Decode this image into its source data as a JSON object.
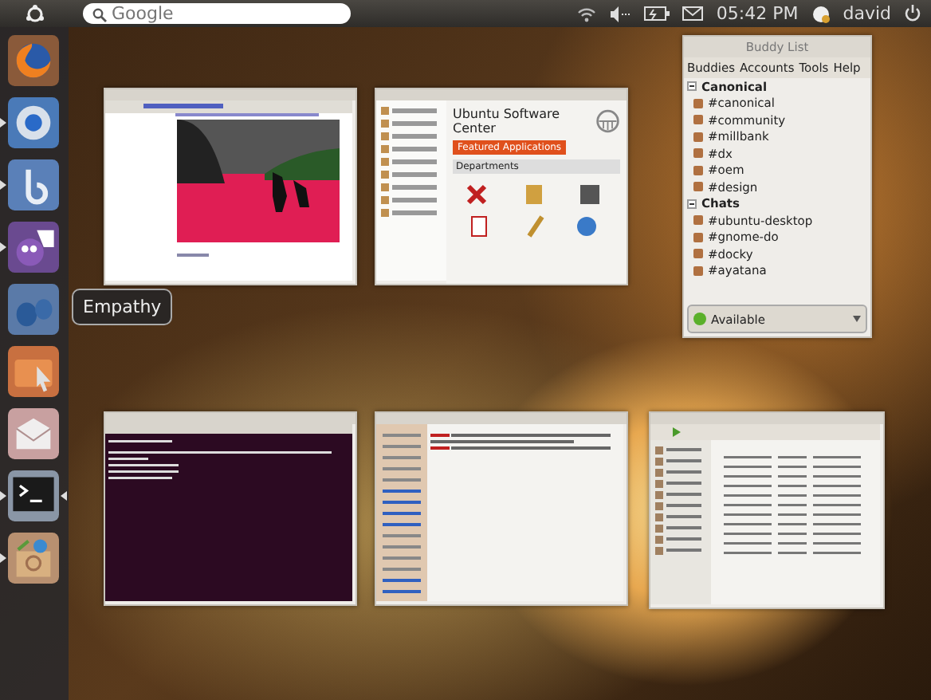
{
  "top_panel": {
    "search": {
      "placeholder": "Google"
    },
    "clock": "05:42 PM",
    "user": "david"
  },
  "launcher": {
    "items": [
      {
        "kind": "firefox",
        "running": false,
        "active": false
      },
      {
        "kind": "chromium",
        "running": true,
        "active": false
      },
      {
        "kind": "bird",
        "running": true,
        "active": false
      },
      {
        "kind": "pidgin",
        "running": true,
        "active": false
      },
      {
        "kind": "empathy",
        "running": false,
        "active": false
      },
      {
        "kind": "files",
        "running": false,
        "active": false
      },
      {
        "kind": "mail",
        "running": false,
        "active": false
      },
      {
        "kind": "terminal",
        "running": true,
        "active": true
      },
      {
        "kind": "software",
        "running": true,
        "active": false
      }
    ],
    "tooltip": "Empathy"
  },
  "windows": [
    {
      "kind": "browser"
    },
    {
      "kind": "software",
      "title": "Ubuntu Software Center",
      "featured": "Featured Applications",
      "departments": "Departments"
    },
    {
      "kind": "buddies",
      "title": "Buddy List",
      "menu": [
        "Buddies",
        "Accounts",
        "Tools",
        "Help"
      ],
      "groups": [
        {
          "name": "Canonical",
          "expanded": true,
          "children": [
            "#canonical",
            "#community",
            "#millbank",
            "#dx",
            "#oem",
            "#design"
          ]
        },
        {
          "name": "Chats",
          "expanded": true,
          "children": [
            "#ubuntu-desktop",
            "#gnome-do",
            "#docky",
            "#ayatana"
          ]
        }
      ],
      "status": "Available"
    },
    {
      "kind": "terminal"
    },
    {
      "kind": "chat"
    },
    {
      "kind": "music"
    }
  ]
}
